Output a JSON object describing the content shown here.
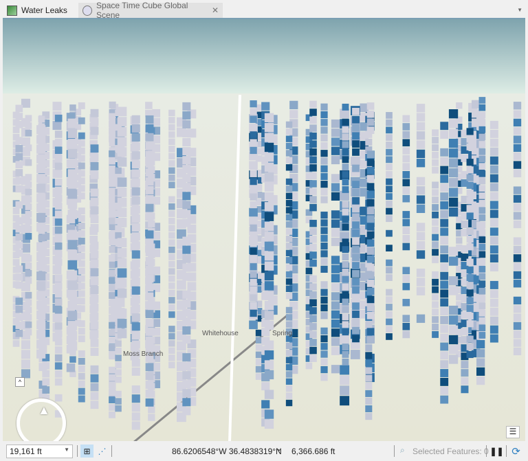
{
  "tabs": [
    {
      "label": "Water Leaks",
      "icon": "map-icon",
      "active": false
    },
    {
      "label": "Space Time Cube Global Scene",
      "icon": "globe-icon",
      "active": true
    }
  ],
  "map_labels": [
    "Whitehouse",
    "Moss Branch",
    "Spring"
  ],
  "status": {
    "scale": "19,161 ft",
    "coordinates": "86.6206548°W 36.4838319°N",
    "elevation": "6,366.686 ft",
    "selected_features": "Selected Features: 0"
  },
  "colors": {
    "accent": "#2d7fc1",
    "sky_top": "#7fa4ae",
    "sky_bottom": "#dfeee6",
    "cube_light": "#d0d0dd",
    "cube_dark": "#0c4a76"
  }
}
